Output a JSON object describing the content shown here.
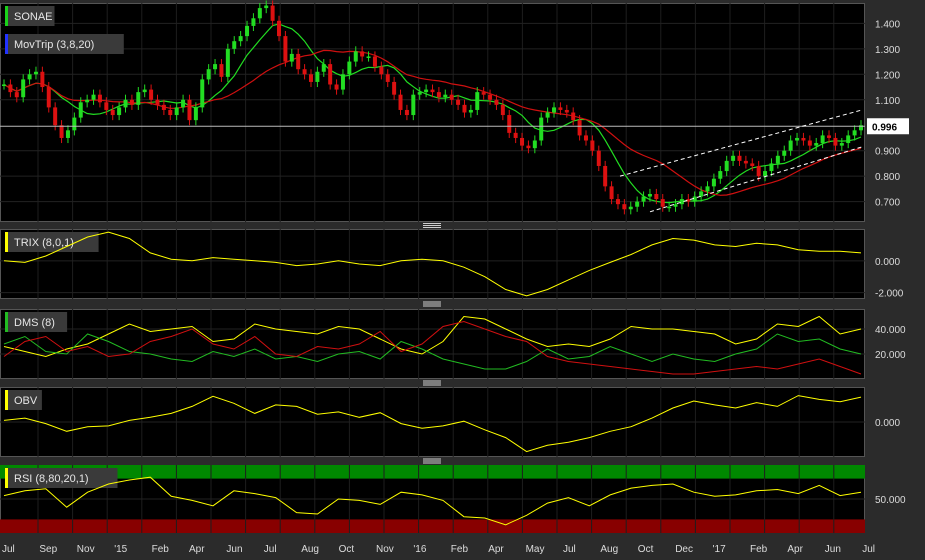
{
  "chart_data": [
    {
      "type": "candlestick",
      "panel": "price",
      "legend": [
        {
          "label": "SONAE",
          "color": "#19d219"
        },
        {
          "label": "MovTrip (3,8,20)",
          "color": "#2233ff"
        }
      ],
      "last_price": "0.996",
      "yticks": [
        "1.400",
        "1.300",
        "1.200",
        "1.100",
        "0.900",
        "0.800",
        "0.700"
      ],
      "ylim": [
        0.62,
        1.48
      ],
      "close_series": [
        1.16,
        1.13,
        1.11,
        1.18,
        1.2,
        1.21,
        1.15,
        1.07,
        1.0,
        0.95,
        0.98,
        1.03,
        1.09,
        1.1,
        1.12,
        1.09,
        1.06,
        1.04,
        1.07,
        1.1,
        1.08,
        1.13,
        1.14,
        1.1,
        1.08,
        1.06,
        1.04,
        1.07,
        1.1,
        1.02,
        1.07,
        1.18,
        1.22,
        1.24,
        1.19,
        1.3,
        1.33,
        1.35,
        1.39,
        1.42,
        1.46,
        1.47,
        1.41,
        1.35,
        1.25,
        1.28,
        1.22,
        1.2,
        1.17,
        1.21,
        1.24,
        1.16,
        1.14,
        1.2,
        1.25,
        1.29,
        1.27,
        1.27,
        1.23,
        1.2,
        1.17,
        1.12,
        1.06,
        1.04,
        1.12,
        1.13,
        1.14,
        1.13,
        1.11,
        1.12,
        1.1,
        1.08,
        1.05,
        1.06,
        1.13,
        1.12,
        1.1,
        1.08,
        1.04,
        0.97,
        0.95,
        0.92,
        0.91,
        0.94,
        1.03,
        1.05,
        1.07,
        1.06,
        1.05,
        1.02,
        0.96,
        0.94,
        0.9,
        0.84,
        0.76,
        0.71,
        0.69,
        0.67,
        0.68,
        0.7,
        0.72,
        0.73,
        0.71,
        0.68,
        0.68,
        0.69,
        0.71,
        0.7,
        0.72,
        0.74,
        0.76,
        0.79,
        0.82,
        0.86,
        0.88,
        0.86,
        0.85,
        0.84,
        0.8,
        0.82,
        0.85,
        0.88,
        0.9,
        0.94,
        0.95,
        0.94,
        0.92,
        0.93,
        0.96,
        0.95,
        0.92,
        0.93,
        0.96,
        0.98,
        1.0
      ],
      "moving_averages": [
        {
          "color": "#22dd22",
          "period": 8
        },
        {
          "color": "#d01010",
          "period": 20
        }
      ],
      "channel": {
        "style": "dashed",
        "color": "#ffffff"
      }
    },
    {
      "type": "line",
      "panel": "TRIX",
      "legend": {
        "label": "TRIX (8,0,1)",
        "color": "#ffff00"
      },
      "yticks": [
        "0.000",
        "-2.000"
      ],
      "ylim": [
        -2.4,
        2.0
      ],
      "values": [
        0.0,
        -0.1,
        0.3,
        0.9,
        1.5,
        1.8,
        1.4,
        0.5,
        0.1,
        0.0,
        0.2,
        0.1,
        0.0,
        -0.1,
        -0.3,
        -0.2,
        0.0,
        -0.2,
        -0.3,
        0.0,
        0.1,
        0.0,
        -0.4,
        -1.0,
        -1.8,
        -2.2,
        -1.8,
        -1.2,
        -0.6,
        -0.1,
        0.4,
        1.0,
        1.4,
        1.3,
        1.0,
        0.9,
        1.1,
        1.0,
        0.7,
        0.6,
        0.6,
        0.5
      ]
    },
    {
      "type": "line",
      "panel": "DMS",
      "legend": {
        "label": "DMS (8)",
        "color": "#22bb22"
      },
      "yticks": [
        "40.000",
        "20.000"
      ],
      "ylim": [
        0,
        56
      ],
      "series": [
        {
          "color": "#ffff00",
          "values": [
            26,
            22,
            18,
            24,
            28,
            36,
            44,
            38,
            40,
            42,
            30,
            32,
            44,
            40,
            38,
            36,
            42,
            40,
            32,
            24,
            20,
            30,
            50,
            48,
            40,
            32,
            26,
            28,
            26,
            32,
            42,
            40,
            40,
            38,
            36,
            28,
            32,
            44,
            42,
            50,
            36,
            40
          ]
        },
        {
          "color": "#22bb22",
          "values": [
            28,
            34,
            22,
            20,
            36,
            30,
            22,
            20,
            16,
            14,
            22,
            18,
            24,
            16,
            18,
            14,
            20,
            22,
            16,
            30,
            24,
            16,
            12,
            8,
            8,
            14,
            24,
            16,
            18,
            26,
            20,
            14,
            20,
            16,
            14,
            20,
            24,
            36,
            30,
            32,
            24,
            20
          ]
        },
        {
          "color": "#d01010",
          "values": [
            18,
            30,
            34,
            22,
            26,
            18,
            20,
            30,
            34,
            40,
            28,
            24,
            34,
            20,
            18,
            26,
            24,
            28,
            38,
            22,
            28,
            42,
            46,
            40,
            34,
            30,
            18,
            14,
            12,
            10,
            8,
            6,
            4,
            4,
            6,
            8,
            10,
            8,
            12,
            16,
            10,
            4
          ]
        }
      ]
    },
    {
      "type": "line",
      "panel": "OBV",
      "legend": {
        "label": "OBV",
        "color": "#ffff00"
      },
      "yticks": [
        "0.000"
      ],
      "ylim": [
        -4.5,
        4.5
      ],
      "values": [
        0.2,
        0.5,
        -0.2,
        -1.2,
        -0.6,
        -0.5,
        0.2,
        0.6,
        1.1,
        2.0,
        3.3,
        2.4,
        1.1,
        2.2,
        2.0,
        1.0,
        1.3,
        0.6,
        1.2,
        -0.2,
        -0.8,
        -0.5,
        0.1,
        -1.0,
        -2.0,
        -3.8,
        -3.0,
        -2.6,
        -2.0,
        -1.2,
        -0.6,
        0.5,
        1.8,
        2.7,
        2.2,
        1.8,
        2.5,
        2.0,
        3.4,
        2.9,
        2.6,
        3.2
      ]
    },
    {
      "type": "line",
      "panel": "RSI",
      "legend": {
        "label": "RSI (8,80,20,1)",
        "color": "#ffff00"
      },
      "yticks": [
        "50.000"
      ],
      "ylim": [
        0,
        100
      ],
      "bands": [
        {
          "from": 80,
          "to": 100,
          "color": "#008800"
        },
        {
          "from": 0,
          "to": 20,
          "color": "#880000"
        }
      ],
      "values": [
        55,
        62,
        65,
        38,
        60,
        72,
        78,
        82,
        54,
        48,
        40,
        62,
        58,
        52,
        30,
        28,
        50,
        48,
        42,
        60,
        56,
        48,
        24,
        22,
        12,
        26,
        44,
        52,
        40,
        56,
        66,
        70,
        72,
        60,
        54,
        56,
        62,
        64,
        58,
        70,
        55,
        60
      ]
    }
  ],
  "x_dates": [
    "Jul",
    "Sep",
    "Nov",
    "'15",
    "Feb",
    "Apr",
    "Jun",
    "Jul",
    "Aug",
    "Oct",
    "Nov",
    "'16",
    "Feb",
    "Apr",
    "May",
    "Jul",
    "Aug",
    "Oct",
    "Dec",
    "'17",
    "Feb",
    "Apr",
    "Jun",
    "Jul"
  ]
}
